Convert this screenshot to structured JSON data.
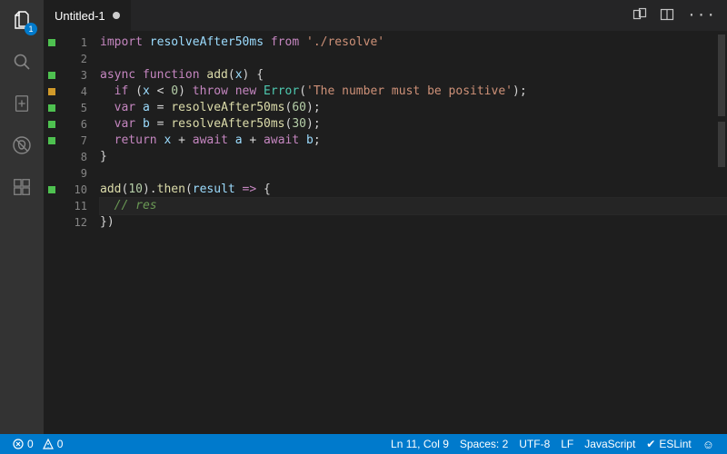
{
  "activity": {
    "explorer_badge": "1"
  },
  "tab": {
    "title": "Untitled-1"
  },
  "code": {
    "lines": [
      {
        "num": "1",
        "bp": "green",
        "tokens": [
          [
            "k",
            "import "
          ],
          [
            "id",
            "resolveAfter50ms"
          ],
          [
            "k",
            " from "
          ],
          [
            "s",
            "'./resolve'"
          ]
        ]
      },
      {
        "num": "2",
        "bp": "",
        "tokens": []
      },
      {
        "num": "3",
        "bp": "green",
        "tokens": [
          [
            "k",
            "async function "
          ],
          [
            "fn",
            "add"
          ],
          [
            "p",
            "("
          ],
          [
            "id",
            "x"
          ],
          [
            "p",
            ") {"
          ]
        ]
      },
      {
        "num": "4",
        "bp": "orange",
        "tokens": [
          [
            "p",
            "  "
          ],
          [
            "k",
            "if"
          ],
          [
            "p",
            " ("
          ],
          [
            "id",
            "x"
          ],
          [
            "op",
            " < "
          ],
          [
            "n",
            "0"
          ],
          [
            "p",
            ") "
          ],
          [
            "k",
            "throw new"
          ],
          [
            "p",
            " "
          ],
          [
            "t",
            "Error"
          ],
          [
            "p",
            "("
          ],
          [
            "s",
            "'The number must be positive'"
          ],
          [
            "p",
            ");"
          ]
        ]
      },
      {
        "num": "5",
        "bp": "green",
        "tokens": [
          [
            "p",
            "  "
          ],
          [
            "k",
            "var"
          ],
          [
            "p",
            " "
          ],
          [
            "id",
            "a"
          ],
          [
            "p",
            " = "
          ],
          [
            "fn",
            "resolveAfter50ms"
          ],
          [
            "p",
            "("
          ],
          [
            "n",
            "60"
          ],
          [
            "p",
            ");"
          ]
        ]
      },
      {
        "num": "6",
        "bp": "green",
        "tokens": [
          [
            "p",
            "  "
          ],
          [
            "k",
            "var"
          ],
          [
            "p",
            " "
          ],
          [
            "id",
            "b"
          ],
          [
            "p",
            " = "
          ],
          [
            "fn",
            "resolveAfter50ms"
          ],
          [
            "p",
            "("
          ],
          [
            "n",
            "30"
          ],
          [
            "p",
            ");"
          ]
        ]
      },
      {
        "num": "7",
        "bp": "green",
        "tokens": [
          [
            "p",
            "  "
          ],
          [
            "k",
            "return"
          ],
          [
            "p",
            " "
          ],
          [
            "id",
            "x"
          ],
          [
            "p",
            " + "
          ],
          [
            "k",
            "await"
          ],
          [
            "p",
            " "
          ],
          [
            "id",
            "a"
          ],
          [
            "p",
            " + "
          ],
          [
            "k",
            "await"
          ],
          [
            "p",
            " "
          ],
          [
            "id",
            "b"
          ],
          [
            "p",
            ";"
          ]
        ]
      },
      {
        "num": "8",
        "bp": "",
        "tokens": [
          [
            "p",
            "}"
          ]
        ]
      },
      {
        "num": "9",
        "bp": "",
        "tokens": []
      },
      {
        "num": "10",
        "bp": "green",
        "tokens": [
          [
            "fn",
            "add"
          ],
          [
            "p",
            "("
          ],
          [
            "n",
            "10"
          ],
          [
            "p",
            ")."
          ],
          [
            "fn",
            "then"
          ],
          [
            "p",
            "("
          ],
          [
            "id",
            "result"
          ],
          [
            "k",
            " => "
          ],
          [
            "p",
            "{"
          ]
        ]
      },
      {
        "num": "11",
        "bp": "",
        "current": true,
        "tokens": [
          [
            "p",
            "  "
          ],
          [
            "c",
            "// res"
          ]
        ]
      },
      {
        "num": "12",
        "bp": "",
        "tokens": [
          [
            "p",
            "})"
          ]
        ]
      }
    ]
  },
  "status": {
    "errors": "0",
    "warnings": "0",
    "cursor": "Ln 11, Col 9",
    "spaces": "Spaces: 2",
    "encoding": "UTF-8",
    "eol": "LF",
    "language": "JavaScript",
    "eslint": "ESLint"
  }
}
